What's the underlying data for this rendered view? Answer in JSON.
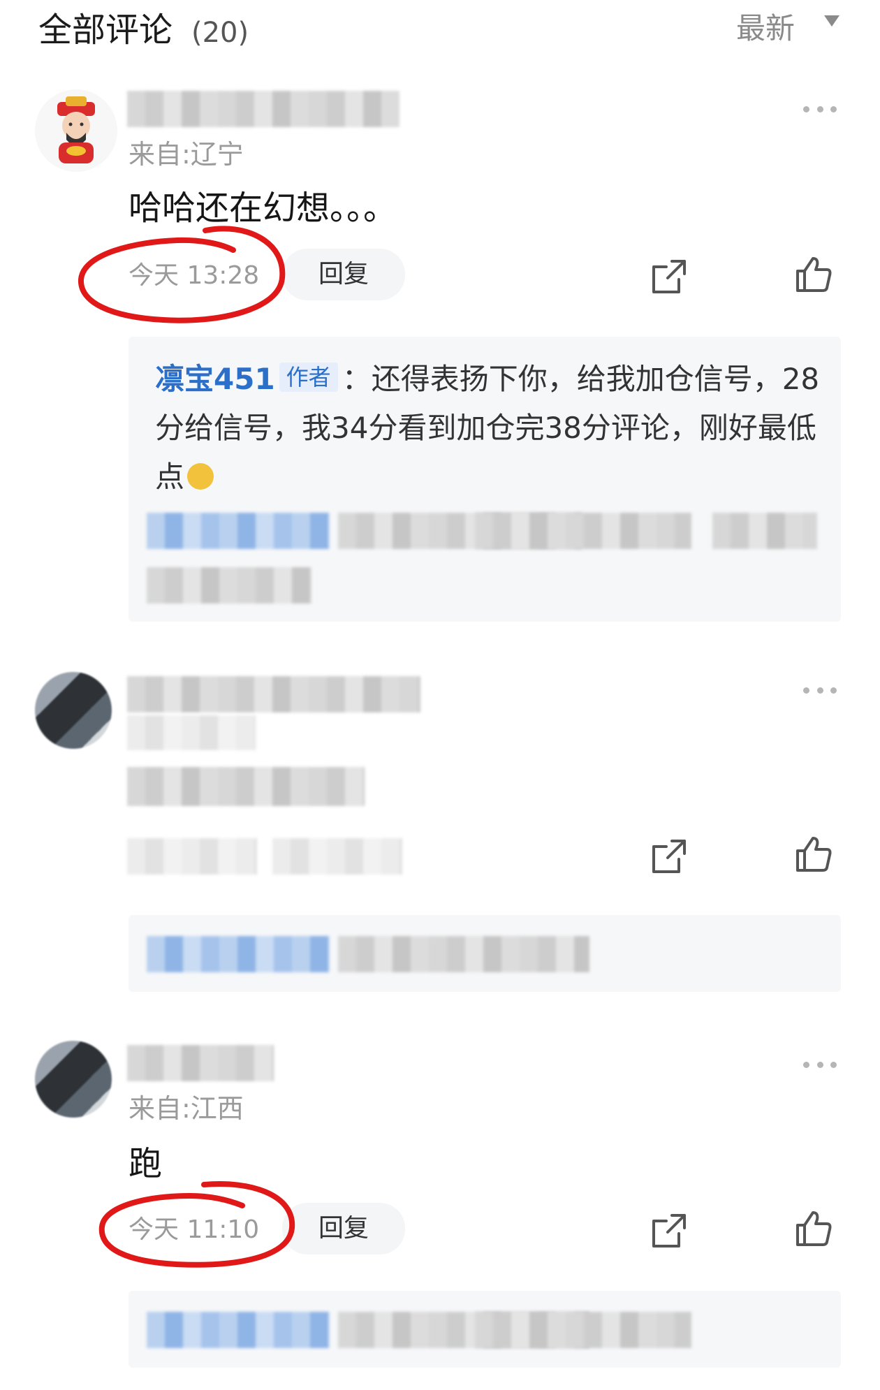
{
  "header": {
    "title": "全部评论",
    "count": "(20)",
    "sort_label": "最新"
  },
  "comments": [
    {
      "region": "来自:辽宁",
      "content": "哈哈还在幻想。。。",
      "time": "今天 13:28",
      "reply_label": "回复",
      "author_reply": {
        "name": "凛宝451",
        "tag": "作者",
        "separator": "：",
        "text": "还得表扬下你，给我加仓信号，28分给信号，我34分看到加仓完38分评论，刚好最低点"
      }
    },
    {
      "time_hidden": true
    },
    {
      "region": "来自:江西",
      "content": "跑",
      "time": "今天 11:10",
      "reply_label": "回复"
    }
  ],
  "icons": {
    "share": "share-icon",
    "like": "thumbs-up-icon",
    "more": "more-options-icon",
    "sort_arrow": "triangle-down-icon"
  },
  "colors": {
    "author_blue": "#2c6fc9",
    "annotation_red": "#e01818"
  }
}
